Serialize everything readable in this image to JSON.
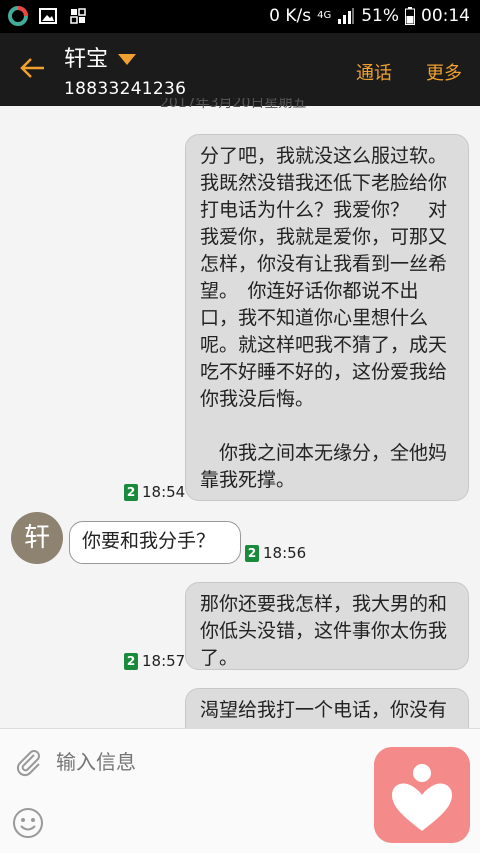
{
  "status": {
    "net": "0 K/s",
    "lte": "4G",
    "battery": "51%",
    "time": "00:14"
  },
  "header": {
    "name": "轩宝",
    "phone": "18833241236",
    "call": "通话",
    "more": "更多"
  },
  "date_partial": "2017年3月20日星期五",
  "messages": [
    {
      "dir": "out",
      "text": "分了吧，我就没这么服过软。我既然没错我还低下老脸给你打电话为什么？我爱你？　对我爱你，我就是爱你，可那又怎样，你没有让我看到一丝希望。　你连好话你都说不出口，我不知道你心里想什么呢。就这样吧我不猜了，成天吃不好睡不好的，这份爱我给你我没后悔。\n\n　你我之间本无缘分，全他妈靠我死撑。",
      "sim": "2",
      "time": "18:54"
    },
    {
      "dir": "in",
      "text": "你要和我分手？",
      "sim": "2",
      "time": "18:56"
    },
    {
      "dir": "out",
      "text": "那你还要我怎样，我大男的和你低头没错，这件事你太伤我了。",
      "sim": "2",
      "time": "18:57"
    },
    {
      "dir": "out",
      "text": "渴望给我打一个电话，你没有",
      "sim": "",
      "time": ""
    }
  ],
  "avatar_text": "轩",
  "input": {
    "placeholder": "输入信息"
  },
  "colors": {
    "accent": "#f0a030",
    "header": "#1b1b1b",
    "sim": "#1a8a3c"
  }
}
